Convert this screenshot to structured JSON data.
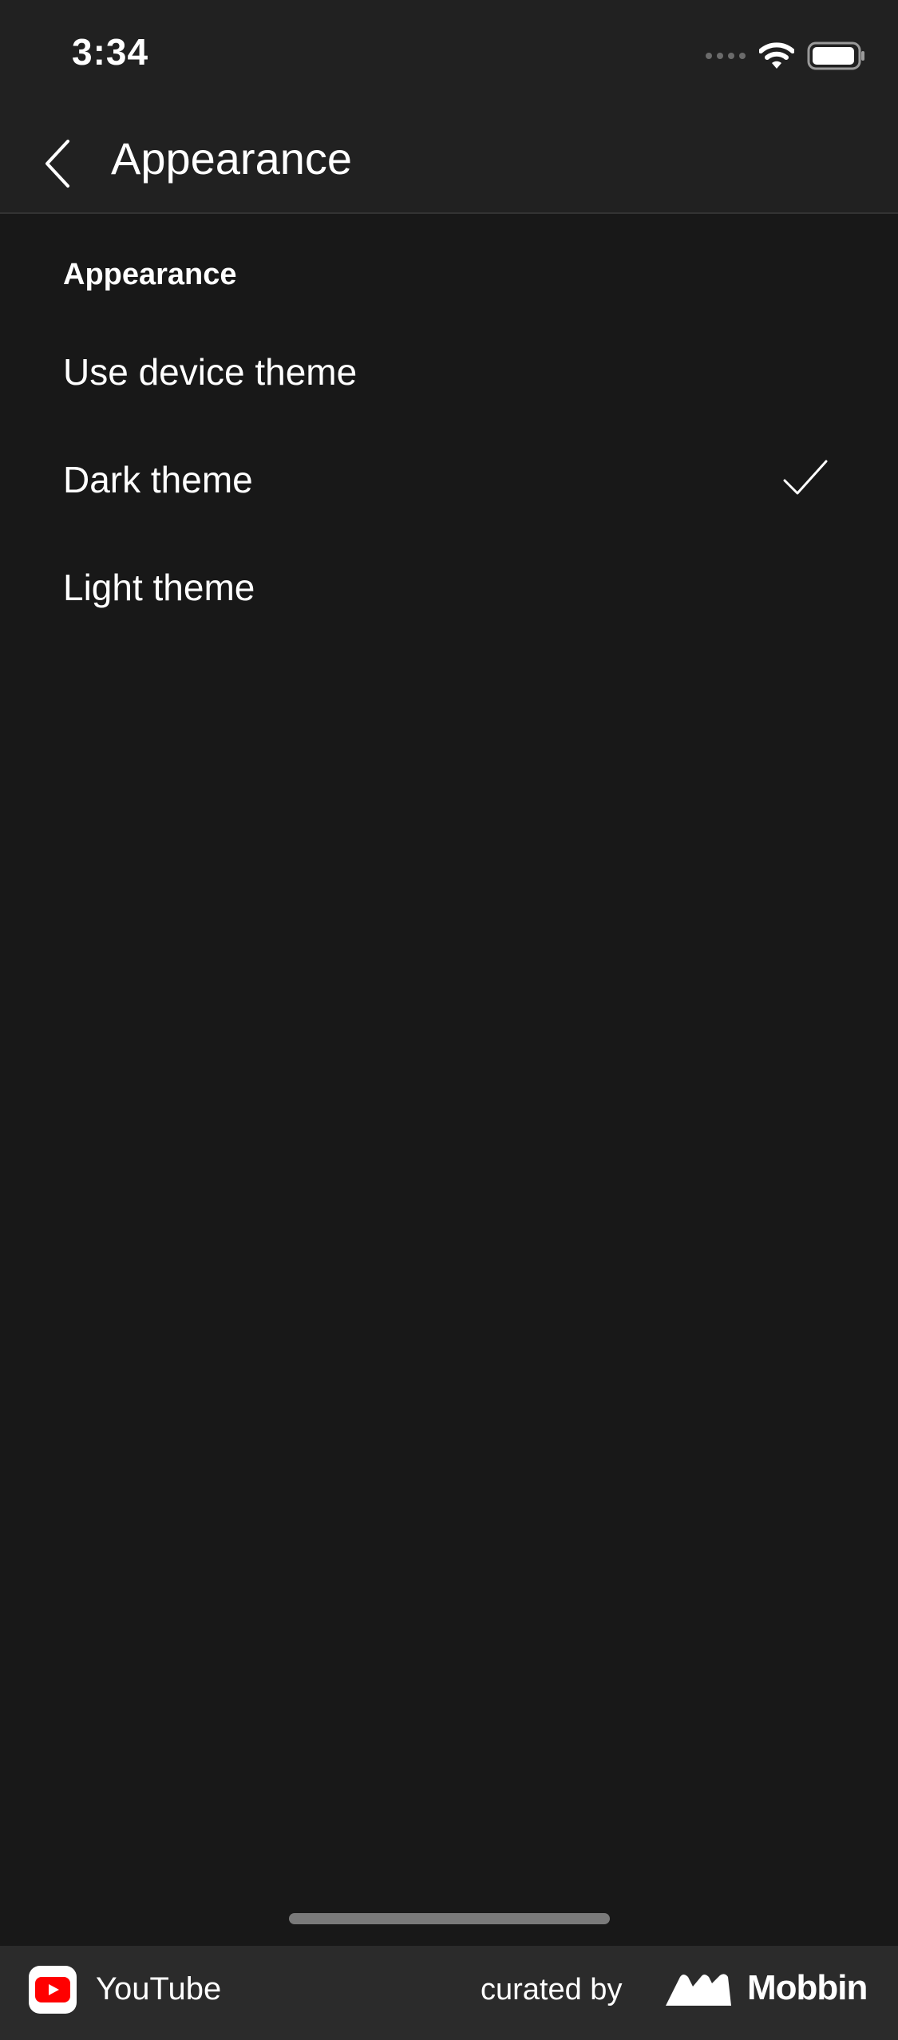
{
  "status_bar": {
    "time": "3:34"
  },
  "header": {
    "title": "Appearance",
    "back_icon": "chevron-left-icon"
  },
  "section": {
    "title": "Appearance",
    "options": [
      {
        "label": "Use device theme",
        "selected": false
      },
      {
        "label": "Dark theme",
        "selected": true
      },
      {
        "label": "Light theme",
        "selected": false
      }
    ]
  },
  "footer": {
    "app_name": "YouTube",
    "curated_label": "curated by",
    "brand_name": "Mobbin"
  },
  "colors": {
    "background": "#181818",
    "header_background": "#212121",
    "footer_background": "#2b2b2b",
    "text": "#ffffff",
    "youtube_red": "#ff0000"
  }
}
